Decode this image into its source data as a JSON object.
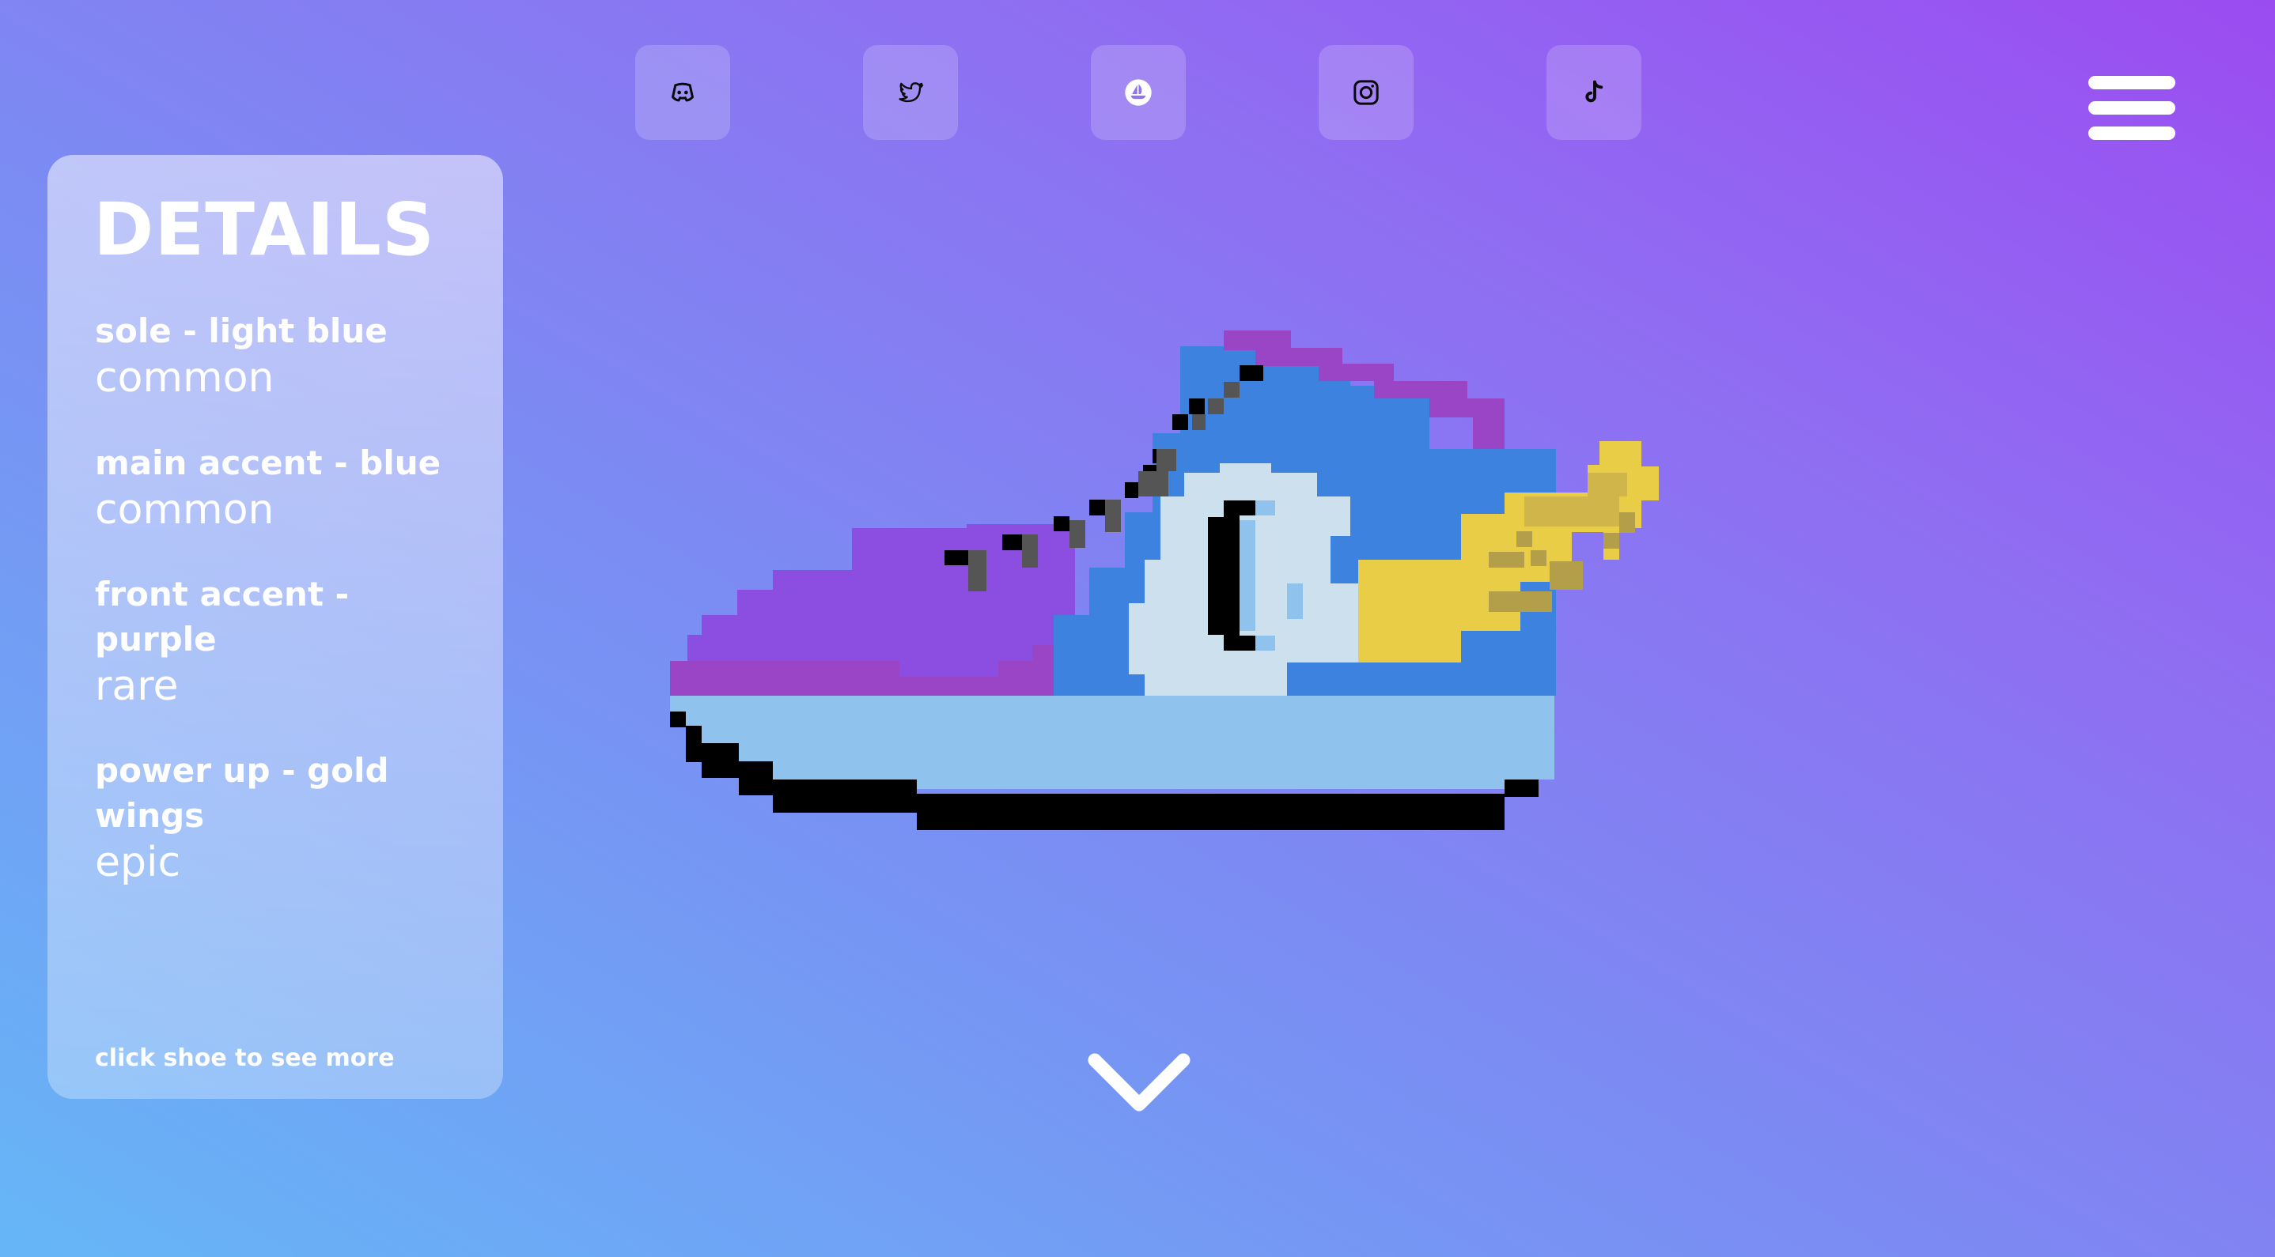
{
  "socials": [
    {
      "name": "discord-icon"
    },
    {
      "name": "twitter-icon"
    },
    {
      "name": "opensea-icon"
    },
    {
      "name": "instagram-icon"
    },
    {
      "name": "tiktok-icon"
    }
  ],
  "details": {
    "title": "DETAILS",
    "traits": [
      {
        "name": "sole - light blue",
        "rarity": "common"
      },
      {
        "name": "main accent - blue",
        "rarity": "common"
      },
      {
        "name": "front accent - purple",
        "rarity": "rare"
      },
      {
        "name": "power up - gold wings",
        "rarity": "epic"
      }
    ],
    "hint": "click shoe to see more"
  },
  "colors": {
    "background_top_right": "#9b4cf1",
    "background_bottom_left": "#66b6f7",
    "sole": "#8fc2ec",
    "main_accent": "#3d82de",
    "front_accent": "#8b4ee0",
    "front_accent_dark": "#9a44c6",
    "wings": "#e9cd47",
    "outline": "#000000"
  }
}
